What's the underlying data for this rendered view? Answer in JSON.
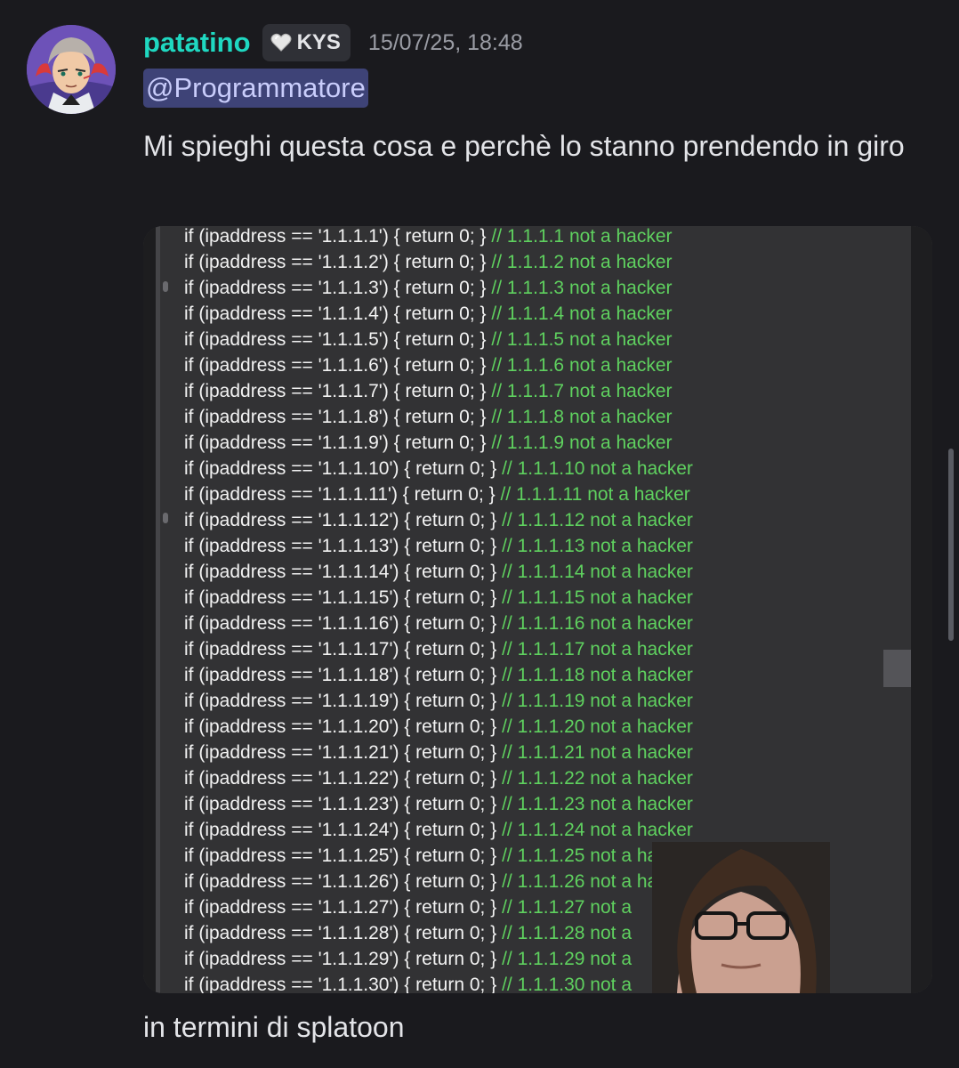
{
  "message": {
    "author": "patatino",
    "tag": {
      "icon": "heart-icon",
      "label": "KYS"
    },
    "timestamp": "15/07/25, 18:48",
    "mention": "@Programmatore",
    "text": "Mi spieghi questa cosa e perchè lo stanno prendendo in giro",
    "followup": "in termini di splatoon"
  },
  "attachment": {
    "code_lines": [
      {
        "code": "if (ipaddress == '1.1.1.1') { return 0; }",
        "comment": "// 1.1.1.1 not a hacker"
      },
      {
        "code": "if (ipaddress == '1.1.1.2') { return 0; }",
        "comment": "// 1.1.1.2 not a hacker"
      },
      {
        "code": "if (ipaddress == '1.1.1.3') { return 0; }",
        "comment": "// 1.1.1.3 not a hacker"
      },
      {
        "code": "if (ipaddress == '1.1.1.4') { return 0; }",
        "comment": "// 1.1.1.4 not a hacker"
      },
      {
        "code": "if (ipaddress == '1.1.1.5') { return 0; }",
        "comment": "// 1.1.1.5 not a hacker"
      },
      {
        "code": "if (ipaddress == '1.1.1.6') { return 0; }",
        "comment": "// 1.1.1.6 not a hacker"
      },
      {
        "code": "if (ipaddress == '1.1.1.7') { return 0; }",
        "comment": "// 1.1.1.7 not a hacker"
      },
      {
        "code": "if (ipaddress == '1.1.1.8') { return 0; }",
        "comment": "// 1.1.1.8 not a hacker"
      },
      {
        "code": "if (ipaddress == '1.1.1.9') { return 0; }",
        "comment": "// 1.1.1.9 not a hacker"
      },
      {
        "code": "if (ipaddress == '1.1.1.10') { return 0; }",
        "comment": "// 1.1.1.10 not a hacker"
      },
      {
        "code": "if (ipaddress == '1.1.1.11') { return 0; }",
        "comment": "// 1.1.1.11 not a hacker"
      },
      {
        "code": "if (ipaddress == '1.1.1.12') { return 0; }",
        "comment": "// 1.1.1.12 not a hacker"
      },
      {
        "code": "if (ipaddress == '1.1.1.13') { return 0; }",
        "comment": "// 1.1.1.13 not a hacker"
      },
      {
        "code": "if (ipaddress == '1.1.1.14') { return 0; }",
        "comment": "// 1.1.1.14 not a hacker"
      },
      {
        "code": "if (ipaddress == '1.1.1.15') { return 0; }",
        "comment": "// 1.1.1.15 not a hacker"
      },
      {
        "code": "if (ipaddress == '1.1.1.16') { return 0; }",
        "comment": "// 1.1.1.16 not a hacker"
      },
      {
        "code": "if (ipaddress == '1.1.1.17') { return 0; }",
        "comment": "// 1.1.1.17 not a hacker"
      },
      {
        "code": "if (ipaddress == '1.1.1.18') { return 0; }",
        "comment": "// 1.1.1.18 not a hacker"
      },
      {
        "code": "if (ipaddress == '1.1.1.19') { return 0; }",
        "comment": "// 1.1.1.19 not a hacker"
      },
      {
        "code": "if (ipaddress == '1.1.1.20') { return 0; }",
        "comment": "// 1.1.1.20 not a hacker"
      },
      {
        "code": "if (ipaddress == '1.1.1.21') { return 0; }",
        "comment": "// 1.1.1.21 not a hacker"
      },
      {
        "code": "if (ipaddress == '1.1.1.22') { return 0; }",
        "comment": "// 1.1.1.22 not a hacker"
      },
      {
        "code": "if (ipaddress == '1.1.1.23') { return 0; }",
        "comment": "// 1.1.1.23 not a hacker"
      },
      {
        "code": "if (ipaddress == '1.1.1.24') { return 0; }",
        "comment": "// 1.1.1.24 not a hacker"
      },
      {
        "code": "if (ipaddress == '1.1.1.25') { return 0; }",
        "comment": "// 1.1.1.25 not a hacker"
      },
      {
        "code": "if (ipaddress == '1.1.1.26') { return 0; }",
        "comment": "// 1.1.1.26 not a ha"
      },
      {
        "code": "if (ipaddress == '1.1.1.27') { return 0; }",
        "comment": "// 1.1.1.27 not a"
      },
      {
        "code": "if (ipaddress == '1.1.1.28') { return 0; }",
        "comment": "// 1.1.1.28 not a"
      },
      {
        "code": "if (ipaddress == '1.1.1.29') { return 0; }",
        "comment": "// 1.1.1.29 not a"
      },
      {
        "code": "if (ipaddress == '1.1.1.30') { return 0; }",
        "comment": "// 1.1.1.30 not a"
      }
    ],
    "colors": {
      "code": "#f2f2f2",
      "comment": "#5fd15f",
      "background": "#323234"
    }
  },
  "colors": {
    "background": "#1a1a1e",
    "username": "#1fd8c1",
    "mention_bg": "#3e4377",
    "mention_text": "#c9cdfb",
    "timestamp": "#9a9ca4"
  }
}
